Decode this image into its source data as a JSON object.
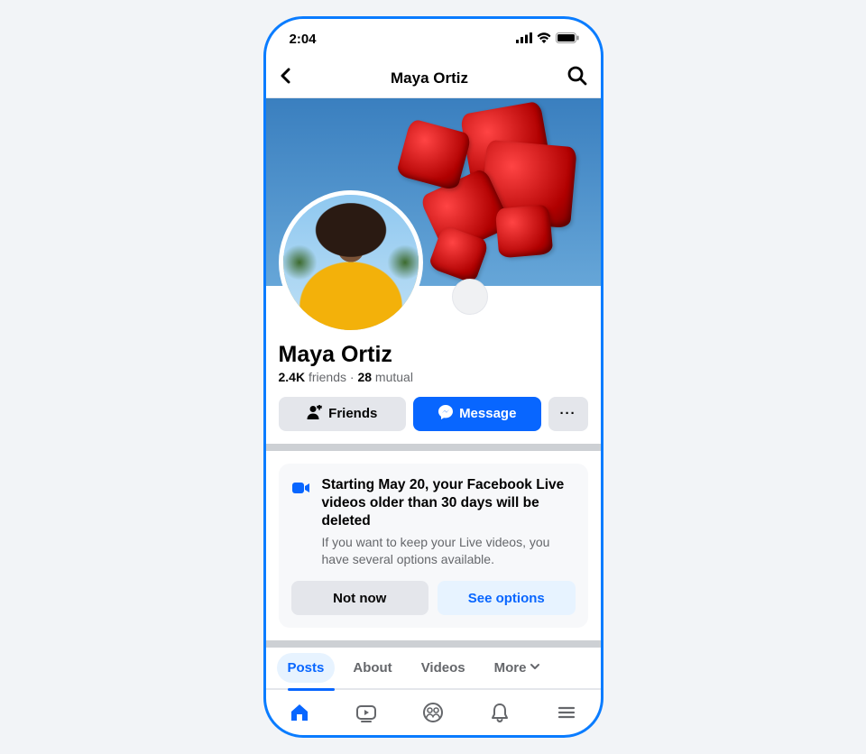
{
  "status": {
    "time": "2:04"
  },
  "nav": {
    "title": "Maya Ortiz"
  },
  "profile": {
    "name": "Maya Ortiz",
    "friends_count": "2.4K",
    "friends_label": "friends",
    "dot": "·",
    "mutual_count": "28",
    "mutual_label": "mutual"
  },
  "actions": {
    "friends": "Friends",
    "message": "Message",
    "more": "···"
  },
  "notice": {
    "title": "Starting May 20, your Facebook Live videos older than 30 days will be deleted",
    "body": "If you want to keep your Live videos, you have several options available.",
    "not_now": "Not now",
    "see_options": "See options"
  },
  "tabs": {
    "posts": "Posts",
    "about": "About",
    "videos": "Videos",
    "more": "More"
  }
}
